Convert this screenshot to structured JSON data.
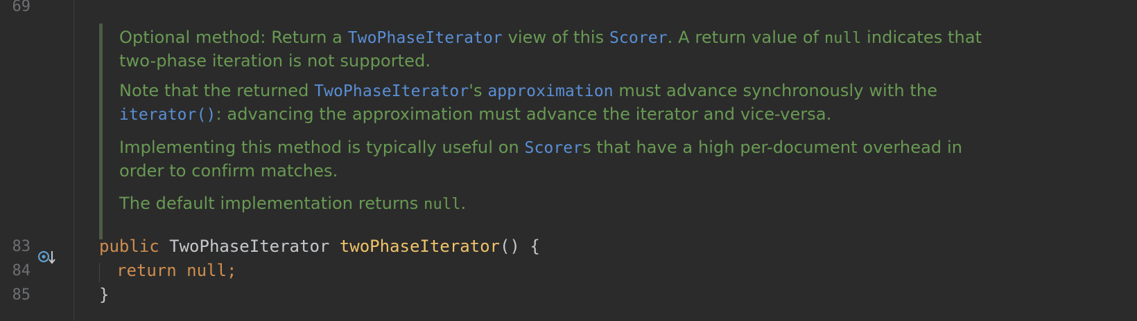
{
  "gutter": {
    "line_numbers": [
      "69",
      "83",
      "84",
      "85"
    ]
  },
  "doc": {
    "p1": {
      "t1": "Optional method: Return a ",
      "l1": "TwoPhaseIterator",
      "t2": " view of this ",
      "l2": "Scorer",
      "t3": ". A return value of ",
      "c1": "null",
      "t4": " indicates that two-phase iteration is not supported."
    },
    "p2": {
      "t1": "Note that the returned ",
      "l1": "TwoPhaseIterator",
      "t2": "'s ",
      "l2": "approximation",
      "t3": " must advance synchronously with the ",
      "l3": "iterator()",
      "t4": ": advancing the approximation must advance the iterator and vice-versa."
    },
    "p3": {
      "t1": "Implementing this method is typically useful on ",
      "l1": "Scorer",
      "t2": "s that have a high per-document overhead in order to confirm matches."
    },
    "p4": {
      "t1": "The default implementation returns ",
      "c1": "null",
      "t2": "."
    }
  },
  "code": {
    "line83": {
      "kw": "public",
      "type": "TwoPhaseIterator",
      "fn": "twoPhaseIterator",
      "rest": "() {"
    },
    "line84": {
      "kw": "return null;"
    },
    "line85": {
      "rest": "}"
    }
  },
  "colors": {
    "background": "#2b2b2b",
    "doc_text": "#699a53",
    "doc_link": "#5a8fd6",
    "keyword": "#cf8e4f",
    "function": "#f0c36a",
    "line_number": "#6e6f72"
  },
  "icons": {
    "gutter_marker": "override-method-icon"
  }
}
